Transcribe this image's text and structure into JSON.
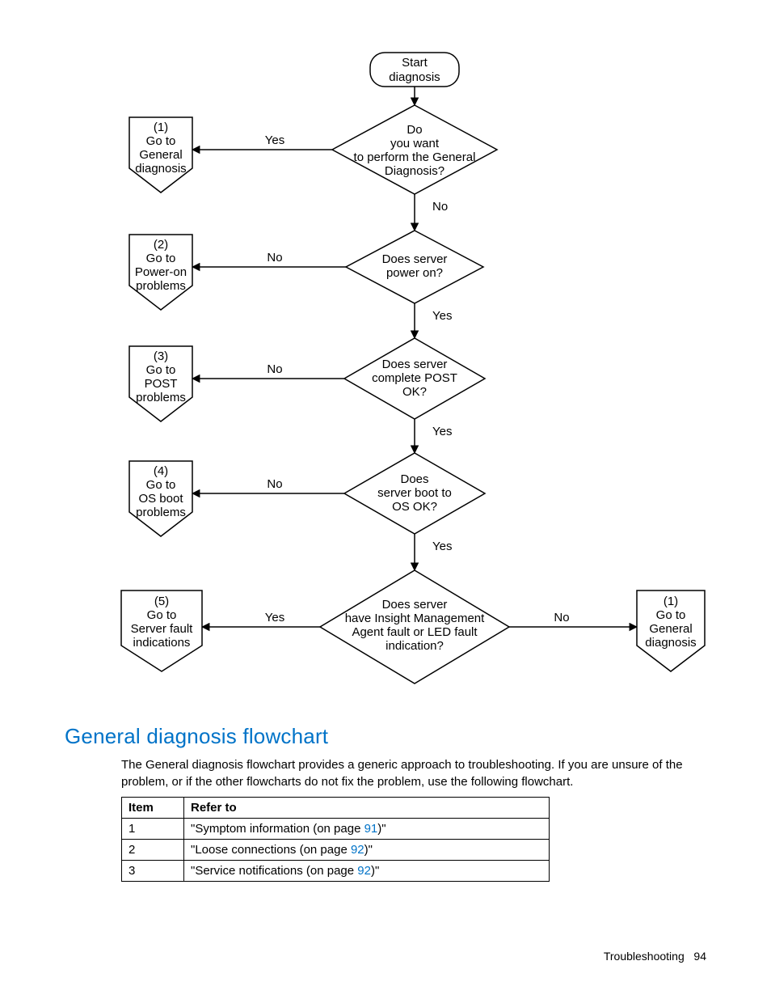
{
  "flowchart": {
    "start": "Start\ndiagnosis",
    "d1": "Do\nyou want\nto perform the General\nDiagnosis?",
    "d2": "Does server\npower on?",
    "d3": "Does server\ncomplete POST\nOK?",
    "d4": "Does\nserver boot to\nOS OK?",
    "d5": "Does server\nhave Insight Management\nAgent fault or LED fault\nindication?",
    "off1": "(1)\nGo to\nGeneral\ndiagnosis",
    "off2": "(2)\nGo to\nPower-on\nproblems",
    "off3": "(3)\nGo to\nPOST\nproblems",
    "off4": "(4)\nGo to\nOS boot\nproblems",
    "off5": "(5)\nGo to\nServer fault\nindications",
    "off6": "(1)\nGo to\nGeneral\ndiagnosis",
    "yes": "Yes",
    "no": "No"
  },
  "heading": "General diagnosis flowchart",
  "paragraph_a": "The General diagnosis flowchart provides a generic approach to troubleshooting. If you are unsure of the",
  "paragraph_b": "problem, or if the other flowcharts do not fix the problem, use the following flowchart.",
  "table": {
    "h1": "Item",
    "h2": "Refer to",
    "rows": [
      {
        "item": "1",
        "pre": "\"Symptom information (on page ",
        "page": "91",
        "post": ")\""
      },
      {
        "item": "2",
        "pre": "\"Loose connections (on page ",
        "page": "92",
        "post": ")\""
      },
      {
        "item": "3",
        "pre": "\"Service notifications (on page ",
        "page": "92",
        "post": ")\""
      }
    ]
  },
  "footer": {
    "section": "Troubleshooting",
    "page": "94"
  }
}
